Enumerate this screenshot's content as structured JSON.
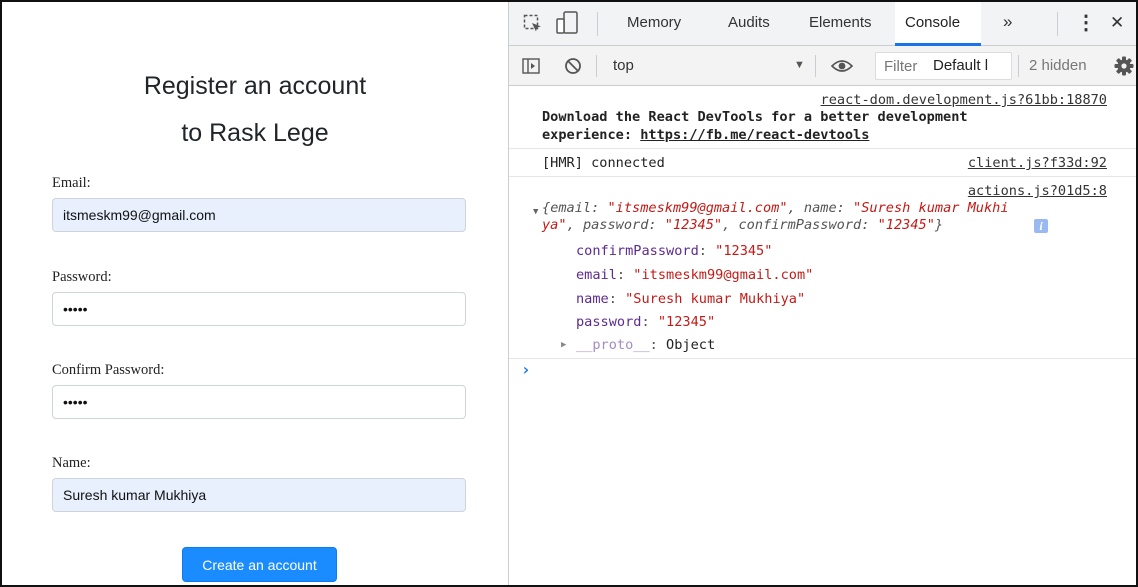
{
  "page": {
    "title_line1": "Register an account",
    "title_line2": "to Rask Lege",
    "fields": [
      {
        "label": "Email",
        "value": "itsmeskm99@gmail.com",
        "placeholder": ""
      },
      {
        "label": "Password",
        "value": "•••••",
        "placeholder": ""
      },
      {
        "label": "Confirm Password",
        "value": "•••••",
        "placeholder": ""
      },
      {
        "label": "Name",
        "value": "Suresh kumar Mukhiya",
        "placeholder": ""
      }
    ],
    "label_suffix": ":",
    "submit_label": "Create an account",
    "colors": {
      "button": "#1a8cff",
      "autofill": "#e8f0fe"
    }
  },
  "devtools": {
    "tabs": [
      "Memory",
      "Audits",
      "Elements",
      "Console"
    ],
    "active_tab": "Console",
    "more_tabs_glyph": "»",
    "menu_glyph": "⋮",
    "close_glyph": "✕",
    "context": "top",
    "context_arrow": "▼",
    "filter_placeholder": "Filter",
    "levels_label": "Default l",
    "hidden_label": "2 hidden",
    "icons": [
      "inspect-element-icon",
      "device-toolbar-icon",
      "sidebar-toggle-icon",
      "clear-console-icon",
      "eye-icon",
      "gear-icon"
    ],
    "accent_color": "#1a73e8"
  },
  "console": {
    "messages": [
      {
        "source": "react-dom.development.js?61bb:18870",
        "text_line1": "Download the React DevTools for a better development",
        "text_line2_prefix": "experience: ",
        "link": "https://fb.me/react-devtools"
      },
      {
        "source": "client.js?f33d:92",
        "text": "[HMR] connected"
      },
      {
        "source": "actions.js?01d5:8",
        "preview_open": "{",
        "preview_close": "}",
        "preview_email_key": "email",
        "preview_email_val": "\"itsmeskm99@gmail.com\"",
        "preview_name_key": "name",
        "preview_name_val_part1": "\"Suresh kumar Mukhi",
        "preview_name_val_part2": "ya\"",
        "preview_password_key": "password",
        "preview_password_val": "\"12345\"",
        "preview_confirm_key": "confirmPassword",
        "preview_confirm_val": "\"12345\"",
        "info_badge": "i",
        "props": [
          {
            "key": "confirmPassword",
            "value": "\"12345\""
          },
          {
            "key": "email",
            "value": "\"itsmeskm99@gmail.com\""
          },
          {
            "key": "name",
            "value": "\"Suresh kumar Mukhiya\""
          },
          {
            "key": "password",
            "value": "\"12345\""
          }
        ],
        "proto_key": "__proto__",
        "proto_value": "Object"
      }
    ],
    "prompt": "›"
  }
}
